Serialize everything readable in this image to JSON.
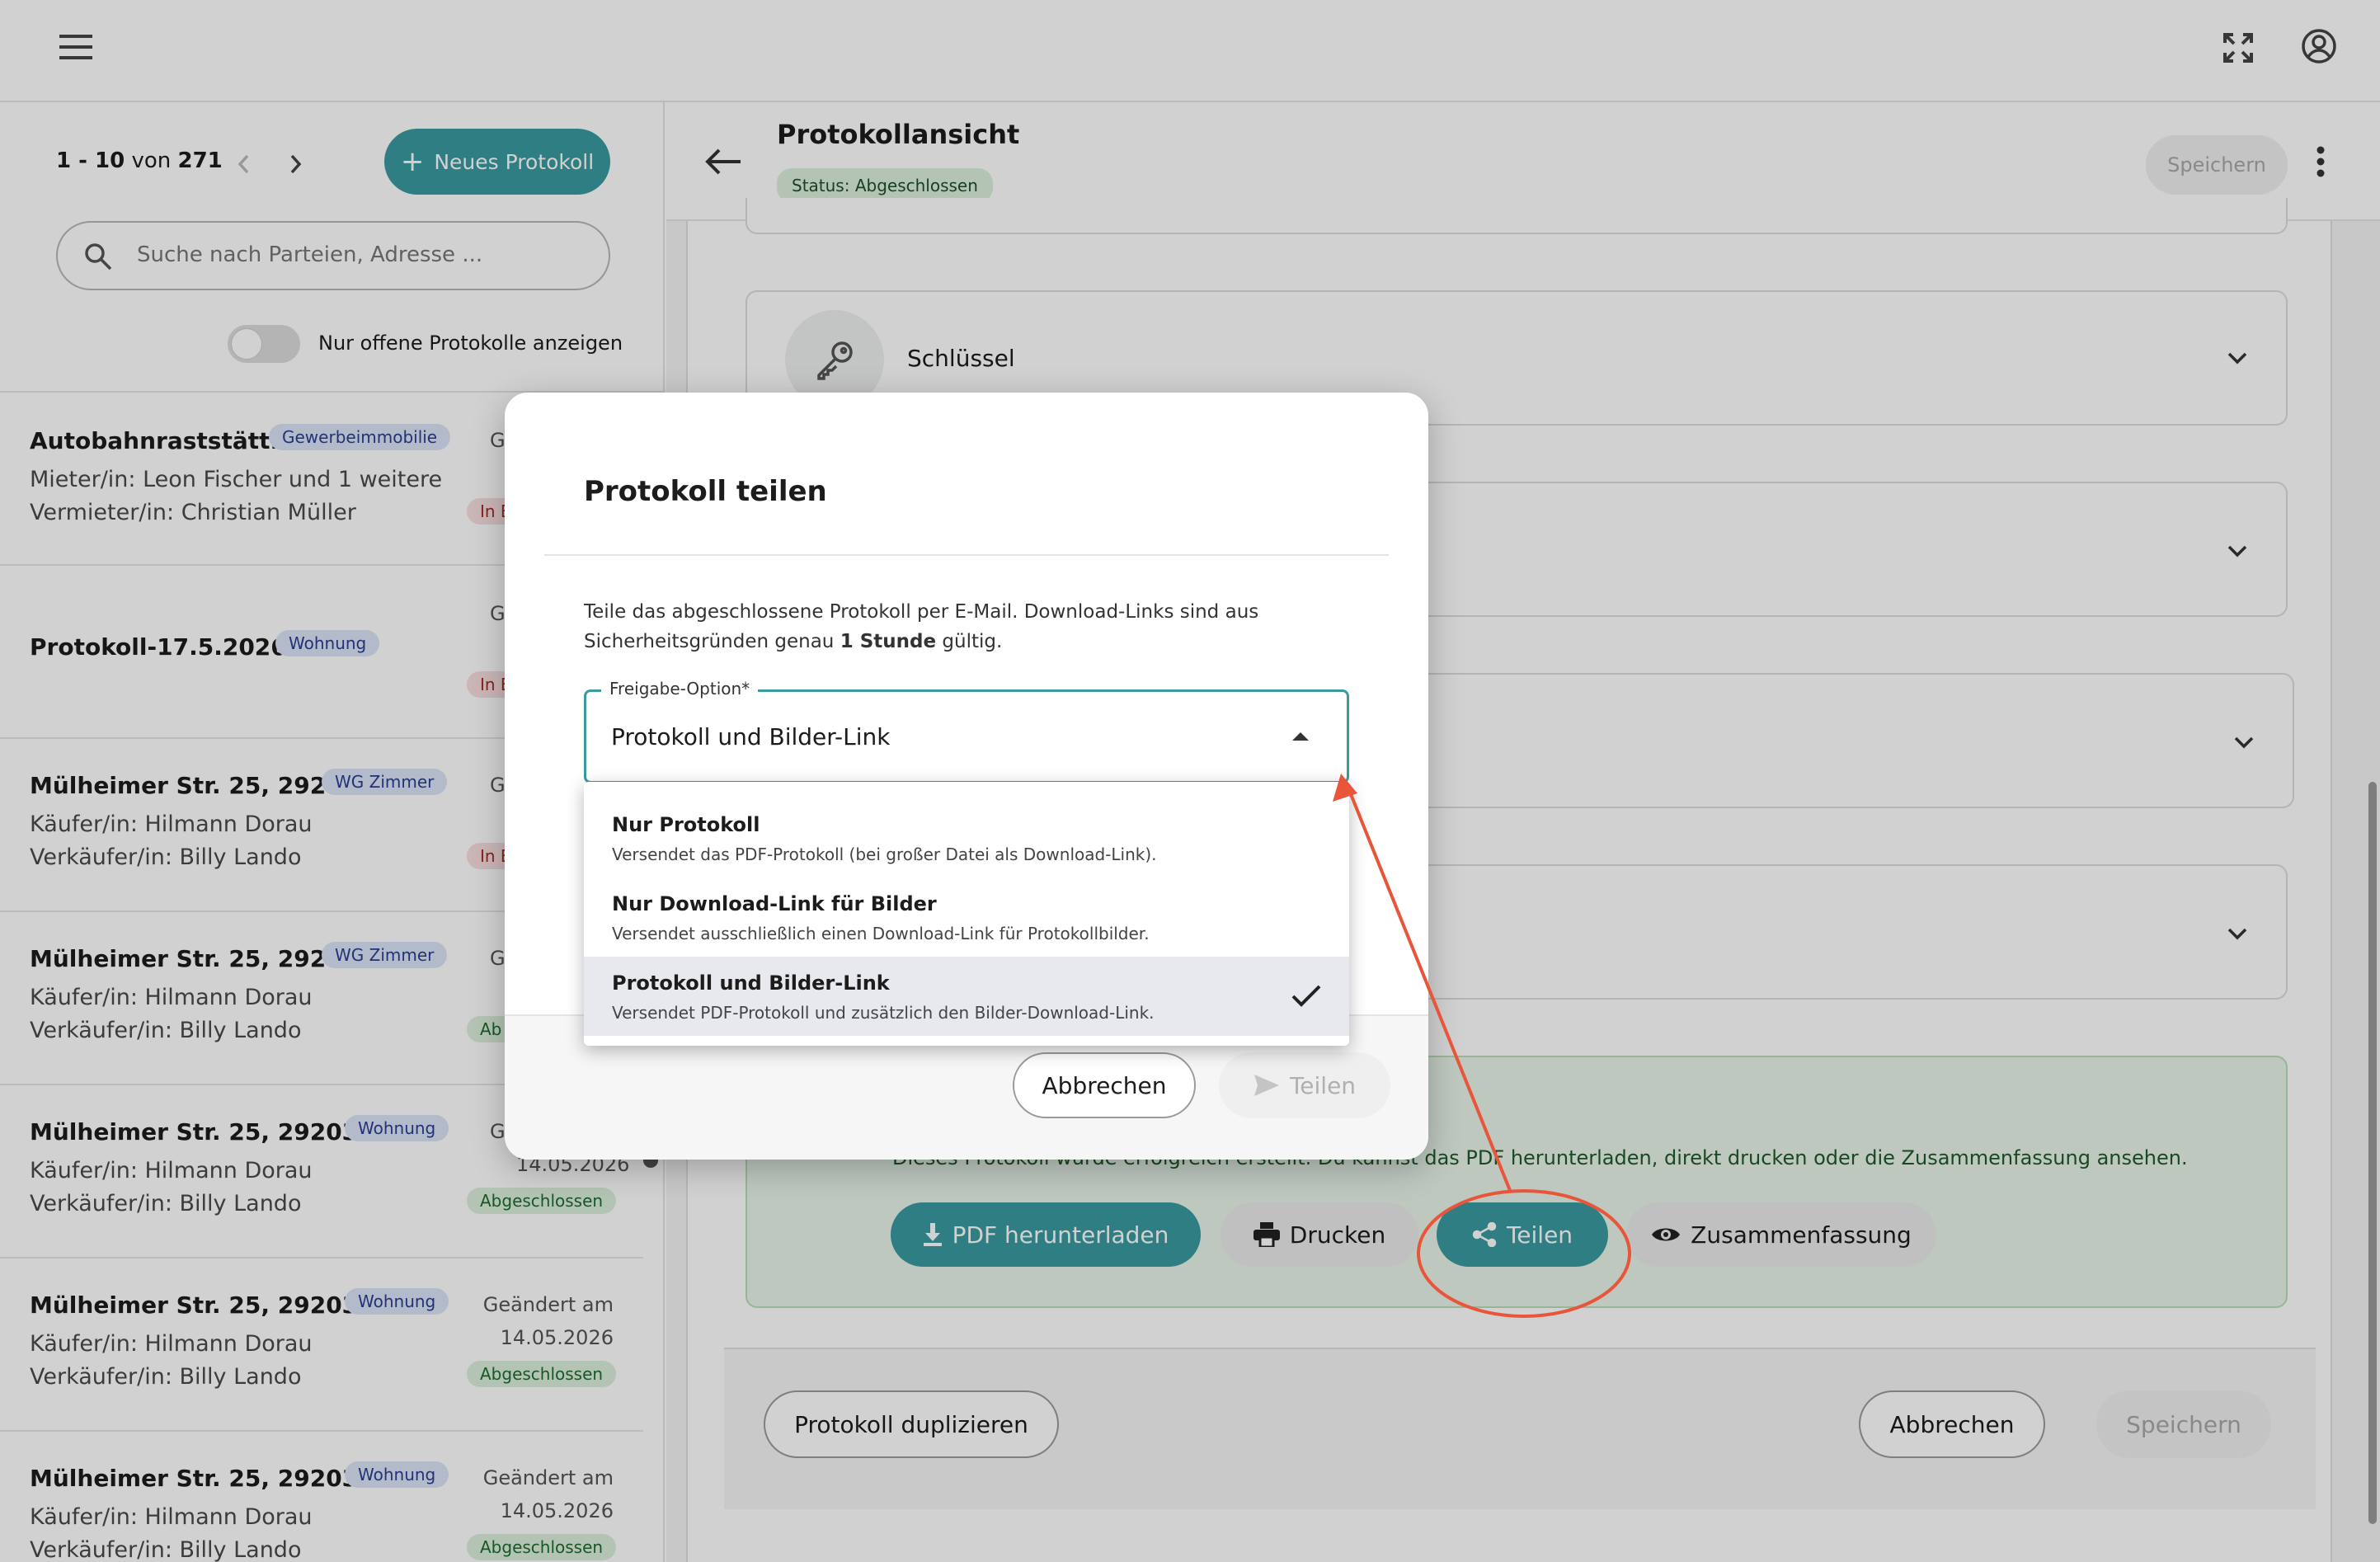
{
  "topbar": {
    "menu_icon": "hamburger-menu-icon",
    "fullscreen_icon": "fullscreen-icon",
    "account_icon": "account-circle-icon"
  },
  "list": {
    "pagination": {
      "range": "1 - 10",
      "of_label": "von",
      "total": "271"
    },
    "new_button": "Neues Protokoll",
    "search_placeholder": "Suche nach Parteien, Adresse ...",
    "toggle_label": "Nur offene Protokolle anzeigen",
    "items": [
      {
        "title": "Autobahnraststätt...",
        "type": "Gewerbeimmobilie",
        "line1": "Mieter/in: Leon Fischer und 1 weitere",
        "line2": "Vermieter/in: Christian Müller",
        "date_label": "G",
        "status": "In B"
      },
      {
        "title": "Protokoll-17.5.2026-2",
        "type": "Wohnung",
        "line1": "",
        "line2": "",
        "date_label": "G",
        "status": "In B"
      },
      {
        "title": "Mülheimer Str. 25, 2920...",
        "type": "WG Zimmer",
        "line1": "Käufer/in: Hilmann Dorau",
        "line2": "Verkäufer/in: Billy Lando",
        "date_label": "G",
        "status": "In B"
      },
      {
        "title": "Mülheimer Str. 25, 2920...",
        "type": "WG Zimmer",
        "line1": "Käufer/in: Hilmann Dorau",
        "line2": "Verkäufer/in: Billy Lando",
        "date_label": "G",
        "status": "Ab"
      },
      {
        "title": "Mülheimer Str. 25, 29203 ...",
        "type": "Wohnung",
        "line1": "Käufer/in: Hilmann Dorau",
        "line2": "Verkäufer/in: Billy Lando",
        "date_label": "G",
        "date": "14.05.2026",
        "status": "Abgeschlossen"
      },
      {
        "title": "Mülheimer Str. 25, 29203 ...",
        "type": "Wohnung",
        "line1": "Käufer/in: Hilmann Dorau",
        "line2": "Verkäufer/in: Billy Lando",
        "date_label": "Geändert am",
        "date": "14.05.2026",
        "status": "Abgeschlossen"
      },
      {
        "title": "Mülheimer Str. 25, 29203 ...",
        "type": "Wohnung",
        "line1": "Käufer/in: Hilmann Dorau",
        "line2": "Verkäufer/in: Billy Lando",
        "date_label": "Geändert am",
        "date": "14.05.2026",
        "status": "Abgeschlossen"
      }
    ]
  },
  "detail": {
    "title": "Protokollansicht",
    "status_prefix": "Status:",
    "status_value": "Abgeschlossen",
    "save_top": "Speichern",
    "section_keys": "Schlüssel",
    "success_text": "Dieses Protokoll wurde erfolgreich erstellt. Du kannst das PDF herunterladen, direkt drucken oder die Zusammenfassung ansehen.",
    "actions": {
      "pdf": "PDF herunterladen",
      "print": "Drucken",
      "share": "Teilen",
      "summary": "Zusammenfassung"
    },
    "footer": {
      "duplicate": "Protokoll duplizieren",
      "cancel": "Abbrechen",
      "save": "Speichern"
    }
  },
  "modal": {
    "title": "Protokoll teilen",
    "desc_1": "Teile das abgeschlossene Protokoll per E-Mail. Download-Links sind aus",
    "desc_2a": "Sicherheitsgründen genau",
    "desc_2b": "1 Stunde",
    "desc_2c": "gültig.",
    "field_label": "Freigabe-Option*",
    "field_value": "Protokoll und Bilder-Link",
    "options": [
      {
        "label": "Nur Protokoll",
        "desc": "Versendet das PDF-Protokoll (bei großer Datei als Download-Link)."
      },
      {
        "label": "Nur Download-Link für Bilder",
        "desc": "Versendet ausschließlich einen Download-Link für Protokollbilder."
      },
      {
        "label": "Protokoll und Bilder-Link",
        "desc": "Versendet PDF-Protokoll und zusätzlich den Bilder-Download-Link.",
        "selected": true
      }
    ],
    "cancel": "Abbrechen",
    "share": "Teilen"
  },
  "colors": {
    "accent": "#3a9aa0",
    "annotation": "#e8553a",
    "success_bg": "#e8f5e9"
  }
}
